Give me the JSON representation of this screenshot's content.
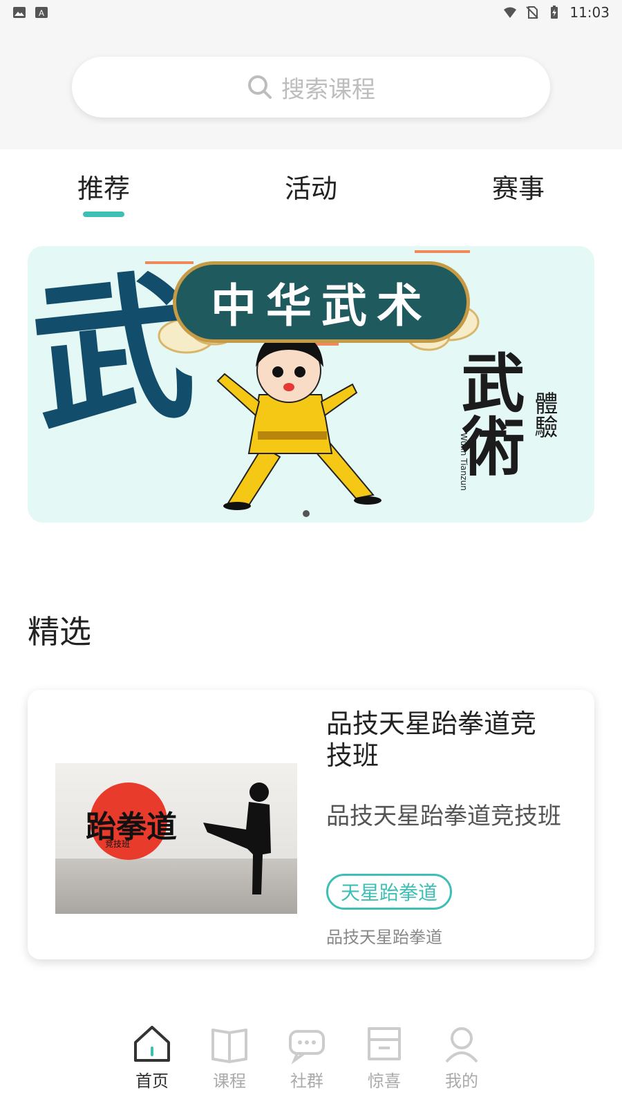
{
  "status_bar": {
    "time": "11:03",
    "icons": [
      "image-icon",
      "font-icon",
      "wifi-icon",
      "no-sim-icon",
      "battery-charging-icon"
    ]
  },
  "search": {
    "placeholder": "搜索课程",
    "icon": "search-icon"
  },
  "tabs": [
    {
      "label": "推荐",
      "active": true
    },
    {
      "label": "活动",
      "active": false
    },
    {
      "label": "赛事",
      "active": false
    }
  ],
  "banner": {
    "title": "中华武术",
    "big_char": "武",
    "side_main": "武術",
    "side_sub": "體驗",
    "side_en": "Wulin Tianzun",
    "active_index": 0,
    "count": 1
  },
  "section": {
    "title": "精选"
  },
  "course_card": {
    "thumb_text": "跆拳道",
    "thumb_sub": "竞技班",
    "title": "品技天星跆拳道竞技班",
    "description": "品技天星跆拳道竞技班",
    "tag": "天星跆拳道",
    "footer": "品技天星跆拳道"
  },
  "bottom_nav": [
    {
      "label": "首页",
      "icon": "home-icon",
      "active": true
    },
    {
      "label": "课程",
      "icon": "book-icon",
      "active": false
    },
    {
      "label": "社群",
      "icon": "chat-icon",
      "active": false
    },
    {
      "label": "惊喜",
      "icon": "store-icon",
      "active": false
    },
    {
      "label": "我的",
      "icon": "profile-icon",
      "active": false
    }
  ],
  "colors": {
    "accent": "#3dbfb6",
    "banner_bg": "#e4f8f5",
    "header_bg": "#f6f6f6"
  }
}
